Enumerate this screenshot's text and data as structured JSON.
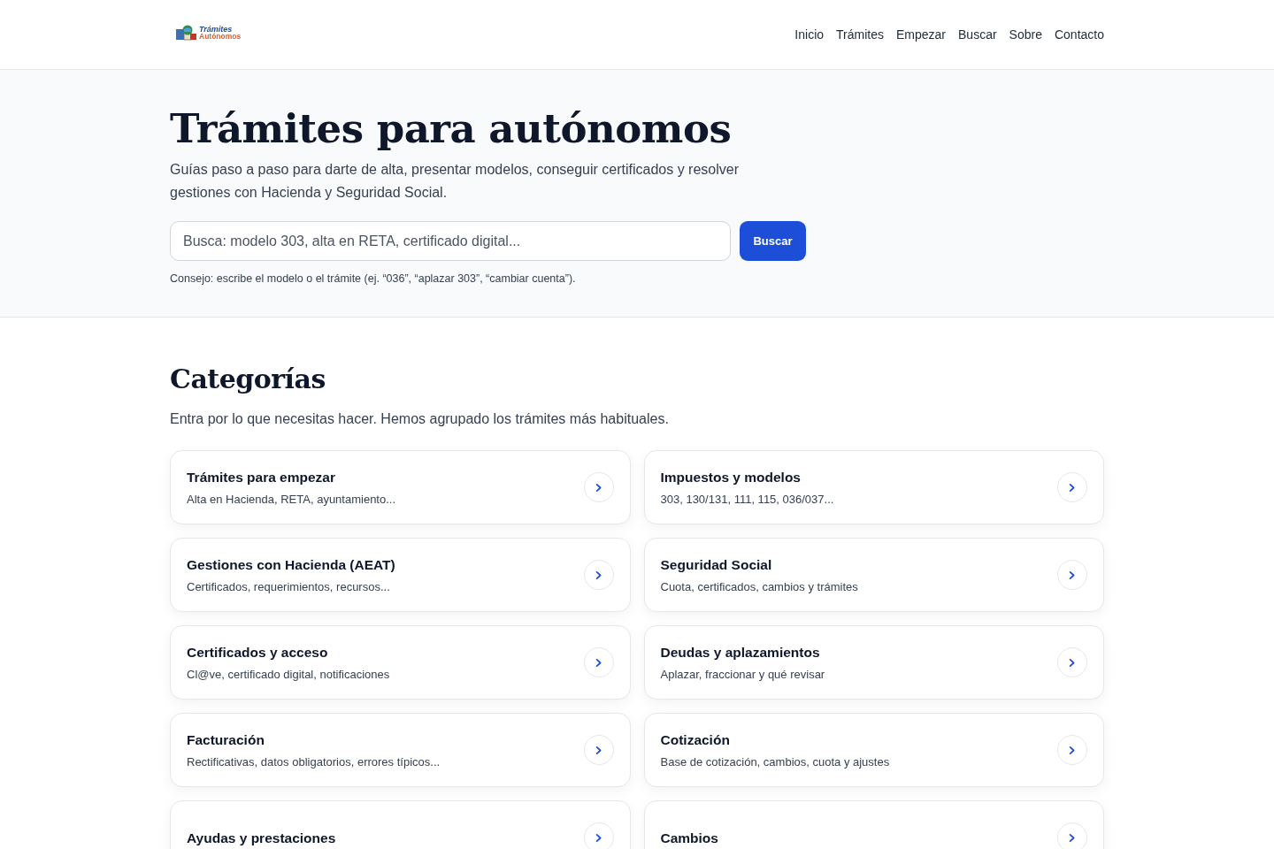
{
  "logo": {
    "line_1": "Trámites",
    "line_2": "Autónomos"
  },
  "nav": [
    {
      "label": "Inicio"
    },
    {
      "label": "Trámites"
    },
    {
      "label": "Empezar"
    },
    {
      "label": "Buscar"
    },
    {
      "label": "Sobre"
    },
    {
      "label": "Contacto"
    }
  ],
  "hero": {
    "title": "Trámites para autónomos",
    "subtitle": "Guías paso a paso para darte de alta, presentar modelos, conseguir certificados y resolver gestiones con Hacienda y Seguridad Social.",
    "search": {
      "placeholder": "Busca: modelo 303, alta en RETA, certificado digital...",
      "button": "Buscar"
    },
    "hint": "Consejo: escribe el modelo o el trámite (ej. “036”, “aplazar 303”, “cambiar cuenta”)."
  },
  "categories": {
    "title": "Categorías",
    "intro": "Entra por lo que necesitas hacer. Hemos agrupado los trámites más habituales.",
    "items": [
      {
        "title": "Trámites para empezar",
        "description": "Alta en Hacienda, RETA, ayuntamiento..."
      },
      {
        "title": "Impuestos y modelos",
        "description": "303, 130/131, 111, 115, 036/037..."
      },
      {
        "title": "Gestiones con Hacienda (AEAT)",
        "description": "Certificados, requerimientos, recursos..."
      },
      {
        "title": "Seguridad Social",
        "description": "Cuota, certificados, cambios y trámites"
      },
      {
        "title": "Certificados y acceso",
        "description": "Cl@ve, certificado digital, notificaciones"
      },
      {
        "title": "Deudas y aplazamientos",
        "description": "Aplazar, fraccionar y qué revisar"
      },
      {
        "title": "Facturación",
        "description": "Rectificativas, datos obligatorios, errores típicos..."
      },
      {
        "title": "Cotización",
        "description": "Base de cotización, cambios, cuota y ajustes"
      },
      {
        "title": "Ayudas y prestaciones"
      },
      {
        "title": "Cambios"
      }
    ]
  }
}
